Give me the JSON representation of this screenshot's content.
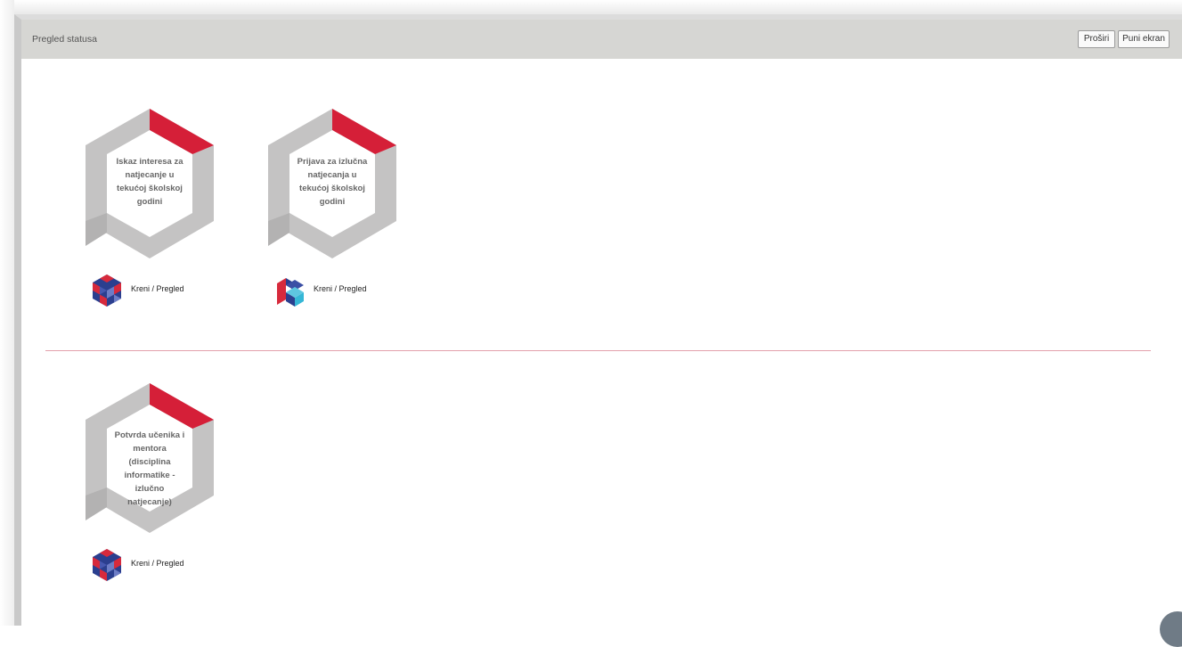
{
  "panel": {
    "title": "Pregled statusa",
    "buttons": {
      "expand": "Proširi",
      "fullscreen": "Puni ekran"
    }
  },
  "colors": {
    "badge_gray": "#c4c3c3",
    "badge_accent": "#d51f38",
    "divider": "#e3a0ab",
    "header_bg": "#d6d6d3"
  },
  "cards": [
    {
      "title": "Iskaz interesa za natjecanje u tekućoj školskoj godini",
      "action": "Kreni / Pregled",
      "logo": "cube-pattern-logo"
    },
    {
      "title": "Prijava za izlučna natjecanja u tekućoj školskoj godini",
      "action": "Kreni / Pregled",
      "logo": "stacked-blocks-logo"
    },
    {
      "title": "Potvrda učenika i mentora (disciplina informatike - izlučno natjecanje)",
      "action": "Kreni / Pregled",
      "logo": "cube-pattern-logo"
    }
  ]
}
